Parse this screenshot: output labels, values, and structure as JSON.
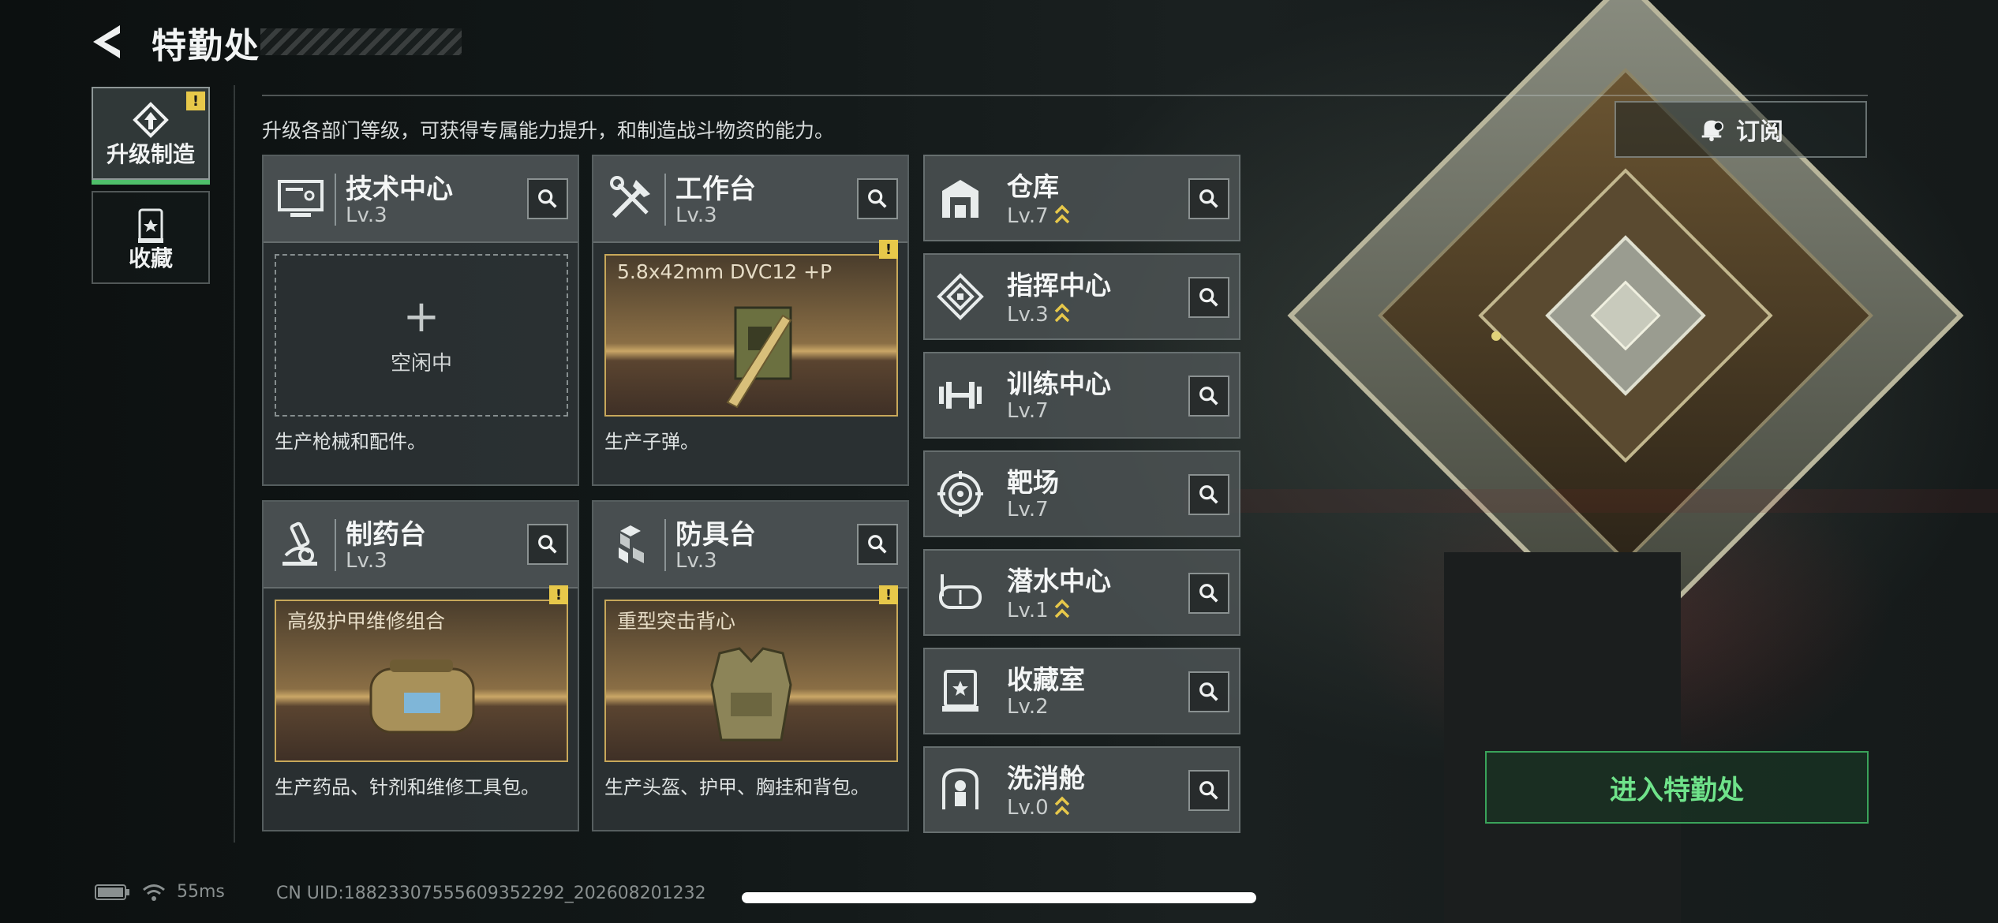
{
  "header": {
    "title": "特勤处"
  },
  "subtitle": "升级各部门等级，可获得专属能力提升，和制造战斗物资的能力。",
  "sidebar": {
    "tabs": [
      {
        "label": "升级制造",
        "active": true,
        "icon": "upgrade-icon",
        "badge": "!"
      },
      {
        "label": "收藏",
        "active": false,
        "icon": "collection-icon"
      }
    ]
  },
  "main_cards": [
    {
      "name": "技术中心",
      "level": "Lv.3",
      "icon": "monitor-icon",
      "slot": {
        "state": "idle",
        "label": "空闲中"
      },
      "desc": "生产枪械和配件。"
    },
    {
      "name": "工作台",
      "level": "Lv.3",
      "icon": "tools-icon",
      "slot": {
        "state": "item",
        "label": "5.8x42mm DVC12 +P",
        "badge": "!"
      },
      "desc": "生产子弹。"
    },
    {
      "name": "制药台",
      "level": "Lv.3",
      "icon": "microscope-icon",
      "slot": {
        "state": "item",
        "label": "高级护甲维修组合",
        "badge": "!"
      },
      "desc": "生产药品、针剂和维修工具包。"
    },
    {
      "name": "防具台",
      "level": "Lv.3",
      "icon": "armor-boxes-icon",
      "slot": {
        "state": "item",
        "label": "重型突击背心",
        "badge": "!"
      },
      "desc": "生产头盔、护甲、胸挂和背包。"
    }
  ],
  "side_facilities": [
    {
      "name": "仓库",
      "level": "Lv.7",
      "upgradable": true,
      "icon": "warehouse-icon"
    },
    {
      "name": "指挥中心",
      "level": "Lv.3",
      "upgradable": true,
      "icon": "command-icon"
    },
    {
      "name": "训练中心",
      "level": "Lv.7",
      "upgradable": false,
      "icon": "dumbbell-icon"
    },
    {
      "name": "靶场",
      "level": "Lv.7",
      "upgradable": false,
      "icon": "target-icon"
    },
    {
      "name": "潜水中心",
      "level": "Lv.1",
      "upgradable": true,
      "icon": "diving-mask-icon"
    },
    {
      "name": "收藏室",
      "level": "Lv.2",
      "upgradable": false,
      "icon": "display-case-icon"
    },
    {
      "name": "洗消舱",
      "level": "Lv.0",
      "upgradable": true,
      "icon": "decon-icon"
    }
  ],
  "subscribe": {
    "label": "订阅"
  },
  "enter": {
    "label": "进入特勤处"
  },
  "status": {
    "ping": "55ms",
    "uid": "CN UID:1882330755560935​2292_202608201232"
  },
  "colors": {
    "accent_green": "#4fbf6a",
    "warning_yellow": "#e7c84a",
    "item_gold": "#c8a85a"
  }
}
